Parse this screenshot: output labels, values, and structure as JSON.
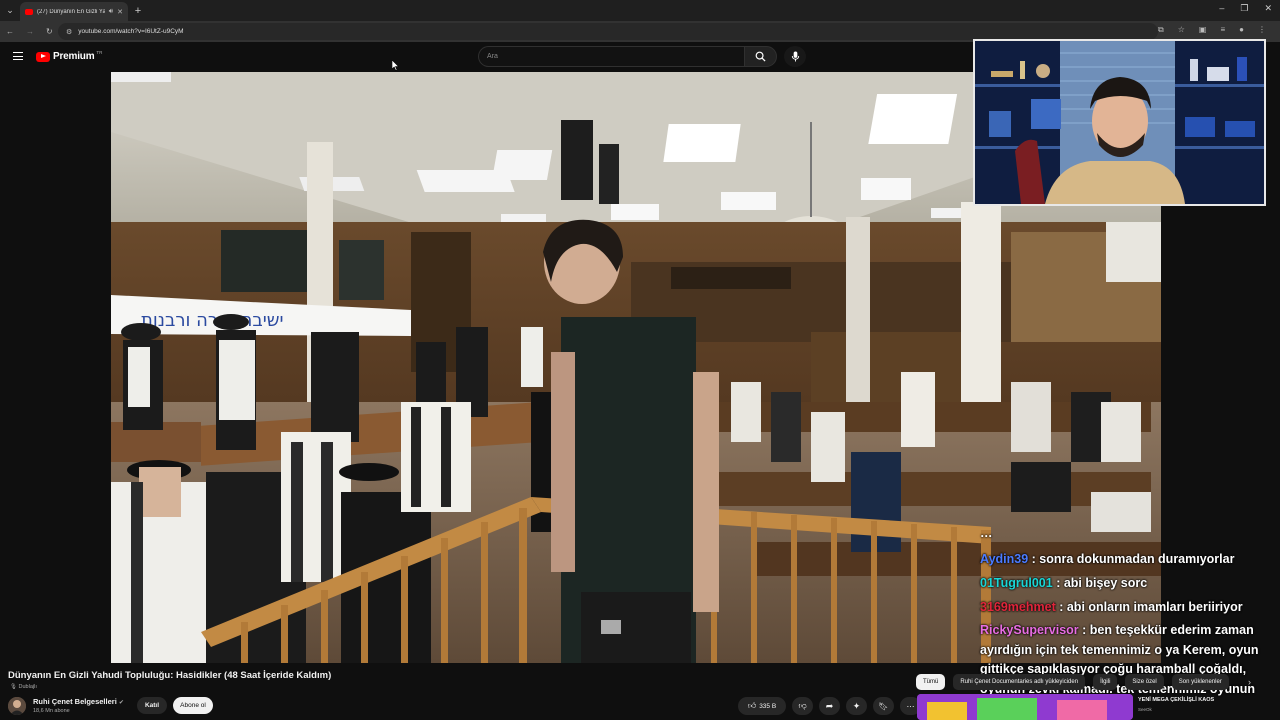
{
  "browser": {
    "tab_title": "(27) Dünyanın En Gizli Yahu…",
    "url": "youtube.com/watch?v=I6UtZ-u9CyM"
  },
  "header": {
    "logo_text": "Premium",
    "logo_region": "TR",
    "search_placeholder": "Ara"
  },
  "video": {
    "banner_text": "ישיבת תורה ורבנות"
  },
  "chat": {
    "messages": [
      {
        "user": "Aydin39",
        "text": " : sonra dokunmadan duramıyorlar",
        "color": "#4b7bff"
      },
      {
        "user": "01Tugrul001",
        "text": " : abi bişey sorc",
        "color": "#19d6d6"
      },
      {
        "user": "3169mehmet",
        "text": " : abi onların imamları beriiriyor",
        "color": "#e0253b"
      },
      {
        "user": "RickySupervisor",
        "text": " : ben teşekkür ederim zaman ayırdığın için tek temennimiz o ya Kerem, oyun gittikçe sapıklaşıyor çoğu haramball çoğaldı, oyunun zevki kalmadı. tek temennimiz oyunun nornale donmesi",
        "color": "#e86de2"
      }
    ]
  },
  "info": {
    "title": "Dünyanın En Gizli Yahudi Topluluğu: Hasidikler (48 Saat İçeride Kaldım)",
    "dubbed_label": "Dublajlı",
    "channel_name": "Ruhi Çenet Belgeselleri",
    "subscribers": "18,6 Mn abone",
    "join_label": "Katıl",
    "subscribe_label": "Abone ol",
    "like_count": "335 B"
  },
  "chips": [
    {
      "label": "Tümü",
      "active": true
    },
    {
      "label": "Ruhi Çenet Documentaries adlı yükleyiciden",
      "active": false
    },
    {
      "label": "İlgili",
      "active": false
    },
    {
      "label": "Size özel",
      "active": false
    },
    {
      "label": "Son yüklenenler",
      "active": false
    }
  ],
  "recommendation": {
    "title": "YENİ MEGA ÇEKİLİŞLİ KAOS",
    "channel": "SeeOk"
  }
}
